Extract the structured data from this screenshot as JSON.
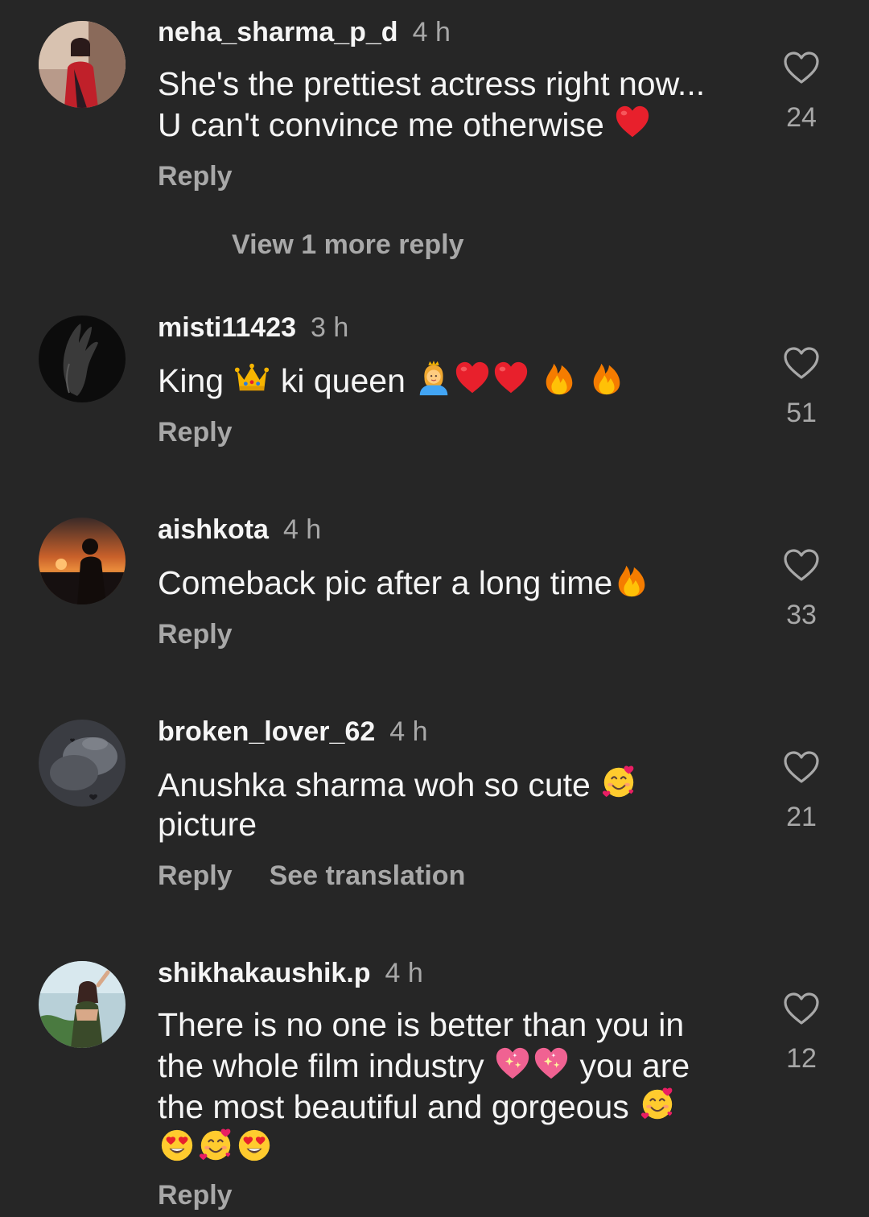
{
  "comments": [
    {
      "username": "neha_sharma_p_d",
      "time": "4 h",
      "text": "She's the prettiest actress right now... U can't convince me otherwise",
      "emojis": [
        "red-heart-emoji"
      ],
      "likes": "24",
      "actions": [
        "Reply"
      ],
      "view_more": "View 1 more reply"
    },
    {
      "username": "misti11423",
      "time": "3 h",
      "text_parts": [
        "King",
        "ki queen"
      ],
      "emojis": [
        "crown-emoji",
        "princess-emoji",
        "red-heart-emoji",
        "red-heart-emoji",
        "fire-emoji",
        "fire-emoji"
      ],
      "likes": "51",
      "actions": [
        "Reply"
      ]
    },
    {
      "username": "aishkota",
      "time": "4 h",
      "text": "Comeback pic after a long time",
      "emojis": [
        "fire-emoji"
      ],
      "likes": "33",
      "actions": [
        "Reply"
      ]
    },
    {
      "username": "broken_lover_62",
      "time": "4 h",
      "text_parts": [
        "Anushka sharma woh so cute",
        "picture"
      ],
      "emojis": [
        "smiling-face-with-hearts-emoji"
      ],
      "likes": "21",
      "actions": [
        "Reply",
        "See translation"
      ]
    },
    {
      "username": "shikhakaushik.p",
      "time": "4 h",
      "text_parts": [
        "There is no one is better than you in the whole film industry",
        "you are the most beautiful and gorgeous"
      ],
      "emojis": [
        "sparkling-heart-emoji",
        "sparkling-heart-emoji",
        "smiling-face-with-hearts-emoji",
        "heart-eyes-emoji",
        "smiling-face-with-hearts-emoji",
        "heart-eyes-emoji"
      ],
      "likes": "12",
      "actions": [
        "Reply"
      ]
    }
  ],
  "colors": {
    "background": "#262626",
    "primary_text": "#f5f5f5",
    "secondary_text": "#a8a8a8"
  }
}
